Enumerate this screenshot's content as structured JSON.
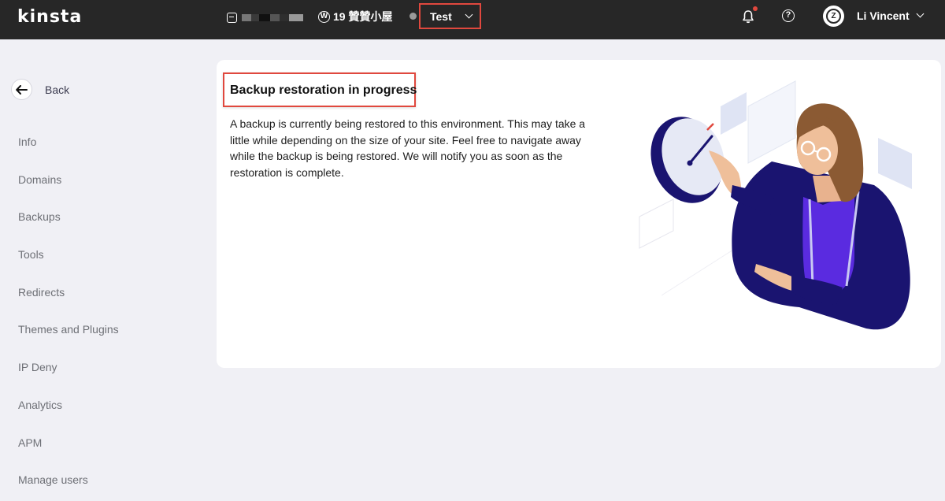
{
  "topbar": {
    "logo": "kinsta",
    "company_icon": "building-icon",
    "site_icon": "wordpress-icon",
    "site_name": "19 贊贊小屋",
    "environment": "Test",
    "notification_icon": "bell-icon",
    "help_icon": "help-icon",
    "user_name": "Li Vincent"
  },
  "sidebar": {
    "back_label": "Back",
    "items": [
      {
        "label": "Info"
      },
      {
        "label": "Domains"
      },
      {
        "label": "Backups"
      },
      {
        "label": "Tools"
      },
      {
        "label": "Redirects"
      },
      {
        "label": "Themes and Plugins"
      },
      {
        "label": "IP Deny"
      },
      {
        "label": "Analytics"
      },
      {
        "label": "APM"
      },
      {
        "label": "Manage users"
      }
    ]
  },
  "main": {
    "title": "Backup restoration in progress",
    "description": "A backup is currently being restored to this environment. This may take a little while depending on the size of your site. Feel free to navigate away while the backup is being restored. We will notify you as soon as the restoration is complete."
  },
  "colors": {
    "topbar_bg": "#272727",
    "page_bg": "#f0f0f5",
    "highlight_border": "#e0483e",
    "illustration_navy": "#1a1470",
    "illustration_purple": "#5a2be0"
  }
}
